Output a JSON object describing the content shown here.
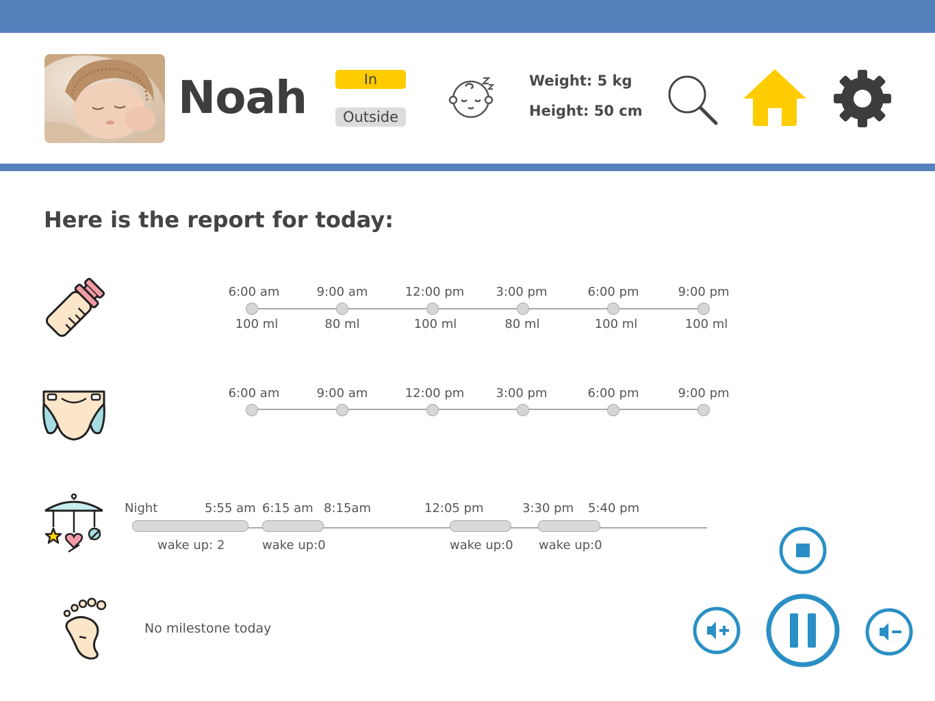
{
  "header": {
    "child_name": "Noah",
    "location_in": "In",
    "location_out": "Outside",
    "weight": "Weight: 5 kg",
    "height": "Height: 50 cm",
    "colors": {
      "bar": "#5480bc",
      "accent": "#ffcc00",
      "control": "#2a8fc4"
    }
  },
  "report": {
    "title": "Here is the report for today:",
    "feeding": {
      "times": [
        "6:00 am",
        "9:00 am",
        "12:00 pm",
        "3:00 pm",
        "6:00 pm",
        "9:00 pm"
      ],
      "amounts": [
        "100 ml",
        "80 ml",
        "100 ml",
        "80 ml",
        "100 ml",
        "100 ml"
      ]
    },
    "diaper": {
      "times": [
        "6:00 am",
        "9:00 am",
        "12:00 pm",
        "3:00 pm",
        "6:00 pm",
        "9:00 pm"
      ]
    },
    "sleep": {
      "labels": [
        "Night",
        "5:55 am",
        "6:15 am",
        "8:15am",
        "12:05 pm",
        "3:30 pm",
        "5:40 pm"
      ],
      "wakeups": [
        "wake up: 2",
        "wake up:0",
        "wake up:0",
        "wake up:0"
      ]
    },
    "milestone": "No milestone today"
  }
}
